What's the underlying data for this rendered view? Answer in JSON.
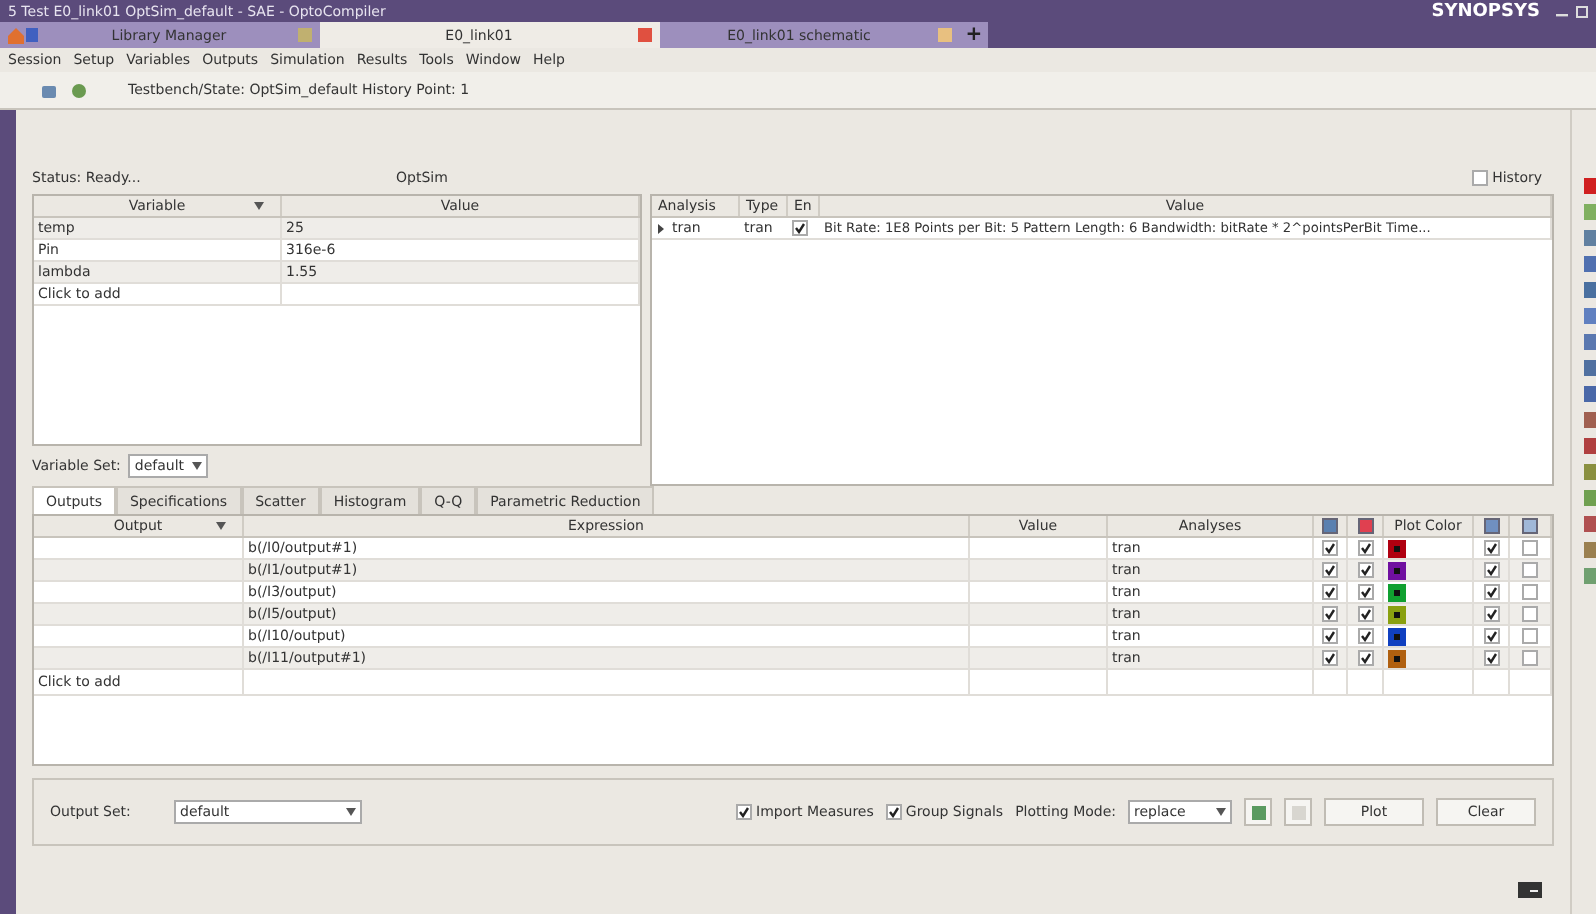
{
  "window": {
    "title": "5 Test E0_link01 OptSim_default - SAE - OptoCompiler",
    "brand": "SYNOPSYS"
  },
  "tabs": [
    {
      "label": "Library Manager",
      "selected": false
    },
    {
      "label": "E0_link01",
      "selected": true
    },
    {
      "label": "E0_link01 schematic",
      "selected": false
    }
  ],
  "new_tab": "+",
  "menu": [
    "Session",
    "Setup",
    "Variables",
    "Outputs",
    "Simulation",
    "Results",
    "Tools",
    "Window",
    "Help"
  ],
  "toolbar": {
    "text": "Testbench/State: OptSim_default History Point: 1"
  },
  "status": {
    "text": "Status: Ready...",
    "tool": "OptSim",
    "history": {
      "label": "History",
      "checked": false
    }
  },
  "variables": {
    "columns": [
      "Variable",
      "Value"
    ],
    "rows": [
      {
        "name": "temp",
        "value": "25"
      },
      {
        "name": "Pin",
        "value": "316e-6"
      },
      {
        "name": "lambda",
        "value": "1.55"
      }
    ],
    "add_row": "Click to add"
  },
  "variable_set": {
    "label": "Variable Set:",
    "value": "default"
  },
  "analyses": {
    "columns": [
      "Analysis",
      "Type",
      "En",
      "Value"
    ],
    "rows": [
      {
        "analysis": "tran",
        "type": "tran",
        "enabled": true,
        "expanded": false,
        "value": "Bit Rate: 1E8 Points per Bit: 5 Pattern Length: 6 Bandwidth: bitRate * 2^pointsPerBit Time..."
      }
    ]
  },
  "bottom_tabs": [
    {
      "label": "Outputs",
      "selected": true
    },
    {
      "label": "Specifications",
      "selected": false
    },
    {
      "label": "Scatter",
      "selected": false
    },
    {
      "label": "Histogram",
      "selected": false
    },
    {
      "label": "Q-Q",
      "selected": false
    },
    {
      "label": "Parametric Reduction",
      "selected": false
    }
  ],
  "outputs": {
    "columns": {
      "output": "Output",
      "expression": "Expression",
      "value": "Value",
      "analyses": "Analyses",
      "plot_color": "Plot Color"
    },
    "rows": [
      {
        "expression": "b(/I0/output#1)",
        "analyses": "tran",
        "column_5_checked": true,
        "column_6_checked": true,
        "color": "#b00010",
        "column_8_checked": true,
        "column_9_checked": false
      },
      {
        "expression": "b(/I1/output#1)",
        "analyses": "tran",
        "column_5_checked": true,
        "column_6_checked": true,
        "color": "#7010a0",
        "column_8_checked": true,
        "column_9_checked": false
      },
      {
        "expression": "b(/I3/output)",
        "analyses": "tran",
        "column_5_checked": true,
        "column_6_checked": true,
        "color": "#10a030",
        "column_8_checked": true,
        "column_9_checked": false
      },
      {
        "expression": "b(/I5/output)",
        "analyses": "tran",
        "column_5_checked": true,
        "column_6_checked": true,
        "color": "#8aa010",
        "column_8_checked": true,
        "column_9_checked": false
      },
      {
        "expression": "b(/I10/output)",
        "analyses": "tran",
        "column_5_checked": true,
        "column_6_checked": true,
        "color": "#1040c0",
        "column_8_checked": true,
        "column_9_checked": false
      },
      {
        "expression": "b(/I11/output#1)",
        "analyses": "tran",
        "column_5_checked": true,
        "column_6_checked": true,
        "color": "#b06010",
        "column_8_checked": true,
        "column_9_checked": false
      }
    ],
    "add_row": "Click to add"
  },
  "footer": {
    "output_set": {
      "label": "Output Set:",
      "value": "default"
    },
    "import_measures": {
      "label": "Import Measures",
      "checked": true
    },
    "group_signals": {
      "label": "Group Signals",
      "checked": true
    },
    "plotting_mode": {
      "label": "Plotting Mode:",
      "value": "replace"
    },
    "buttons": [
      "Plot",
      "Clear"
    ]
  }
}
